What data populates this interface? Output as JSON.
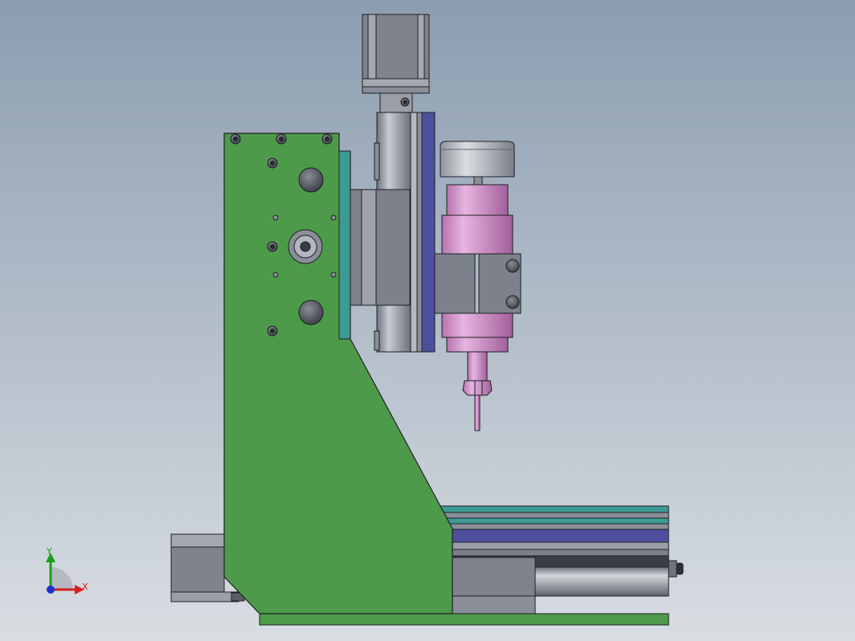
{
  "scene": {
    "background_top": "#8c9db0",
    "background_bottom": "#d8dde2",
    "colors": {
      "frame_green": "#4e9a4b",
      "spindle_pink": "#cf93c8",
      "rail_teal": "#3e9a94",
      "rail_blue": "#4e4f9c",
      "steel_gray": "#7a7f8a",
      "light_steel": "#b6bac2",
      "outline": "#1e2024"
    }
  },
  "triad": {
    "x_label": "X",
    "y_label": "Y",
    "x_color": "#d42020",
    "y_color": "#18a018",
    "z_color": "#1a2ed8"
  }
}
